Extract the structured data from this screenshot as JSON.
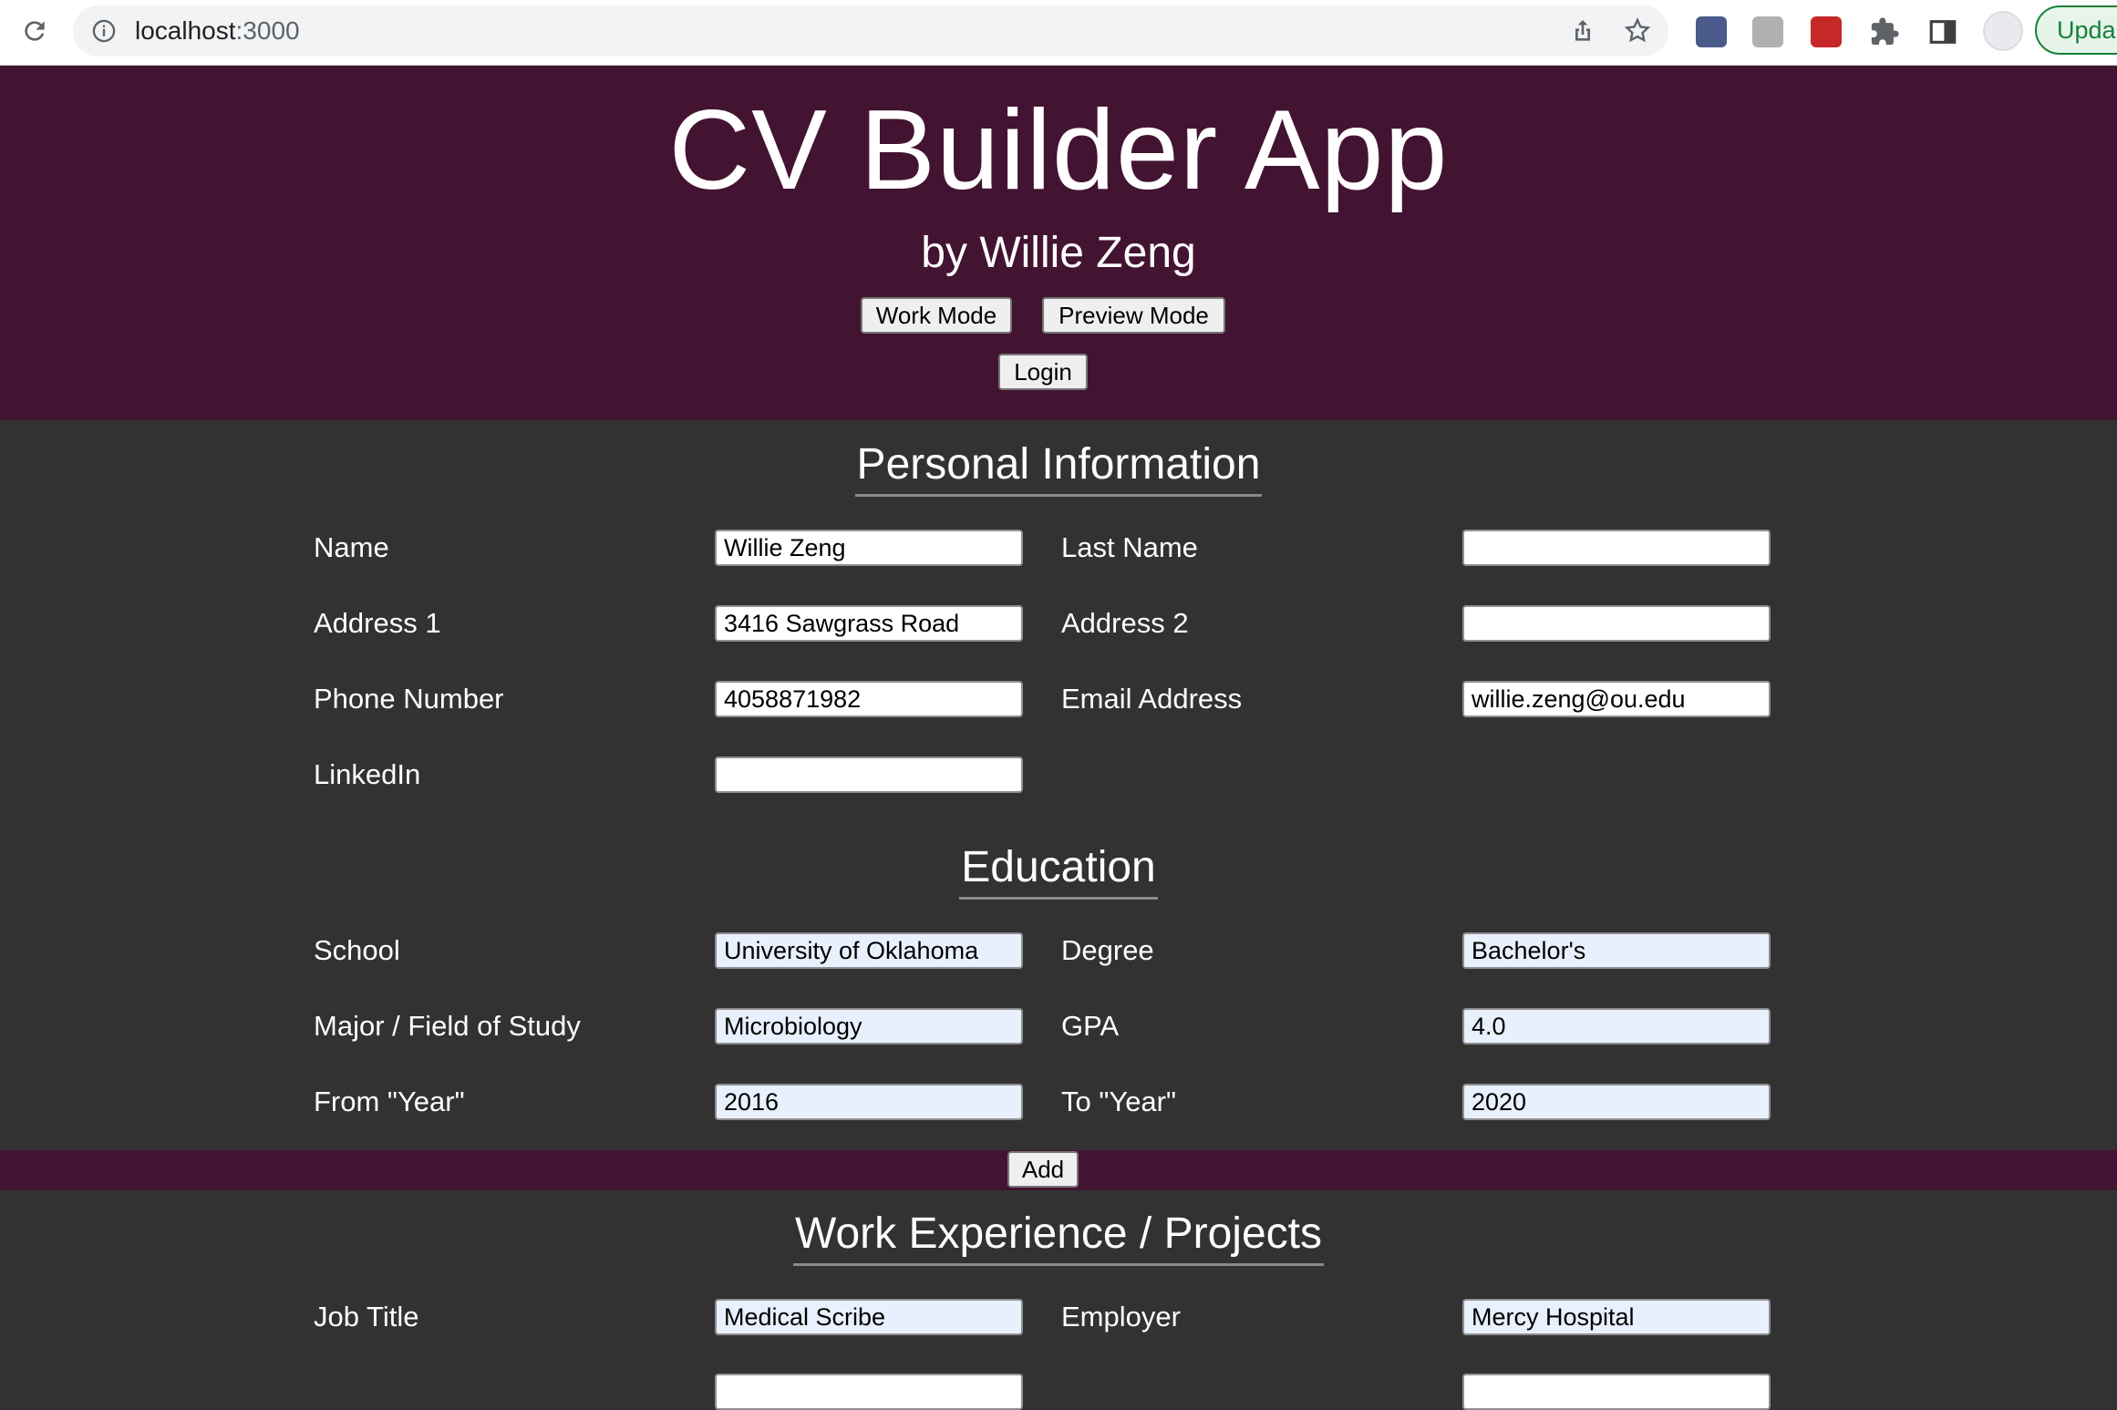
{
  "browser": {
    "url_host": "localhost",
    "url_port": ":3000",
    "update_label": "Upda"
  },
  "header": {
    "title": "CV Builder App",
    "byline": "by Willie Zeng",
    "work_mode_label": "Work Mode",
    "preview_mode_label": "Preview Mode",
    "login_label": "Login"
  },
  "personal": {
    "title": "Personal Information",
    "name_label": "Name",
    "name_value": "Willie Zeng",
    "last_name_label": "Last Name",
    "last_name_value": "",
    "address1_label": "Address 1",
    "address1_value": "3416 Sawgrass Road",
    "address2_label": "Address 2",
    "address2_value": "",
    "phone_label": "Phone Number",
    "phone_value": "4058871982",
    "email_label": "Email Address",
    "email_value": "willie.zeng@ou.edu",
    "linkedin_label": "LinkedIn",
    "linkedin_value": ""
  },
  "education": {
    "title": "Education",
    "school_label": "School",
    "school_value": "University of Oklahoma",
    "degree_label": "Degree",
    "degree_value": "Bachelor's",
    "major_label": "Major / Field of Study",
    "major_value": "Microbiology",
    "gpa_label": "GPA",
    "gpa_value": "4.0",
    "from_label": "From \"Year\"",
    "from_value": "2016",
    "to_label": "To \"Year\"",
    "to_value": "2020",
    "add_label": "Add"
  },
  "work": {
    "title": "Work Experience / Projects",
    "job_title_label": "Job Title",
    "job_title_value": "Medical Scribe",
    "employer_label": "Employer",
    "employer_value": "Mercy Hospital"
  },
  "colors": {
    "header_bg": "#431431",
    "body_bg": "#333233",
    "autofill_bg": "#e8f0fe"
  }
}
